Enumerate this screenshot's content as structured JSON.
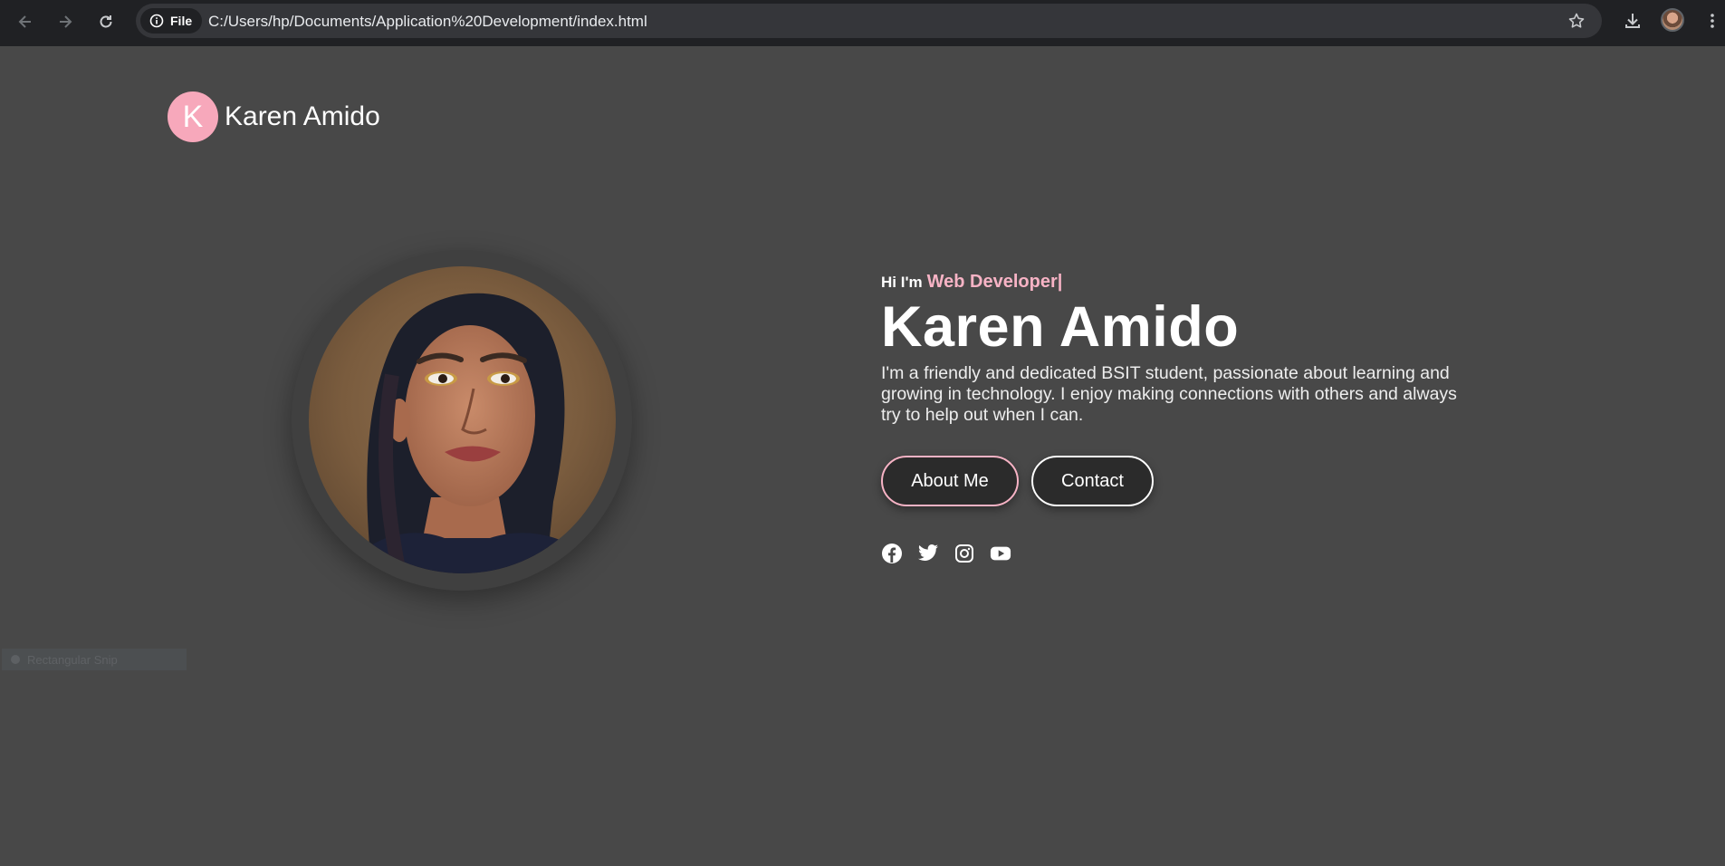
{
  "browser": {
    "chip_label": "File",
    "url": "C:/Users/hp/Documents/Application%20Development/index.html"
  },
  "header": {
    "logo_letter": "K",
    "logo_name": "Karen Amido"
  },
  "hero": {
    "greeting": "Hi I'm",
    "role": "Web Developer|",
    "name": "Karen Amido",
    "bio": "I'm a friendly and dedicated BSIT student, passionate about learning and growing in technology. I enjoy making connections with others and always try to help out when I can."
  },
  "buttons": {
    "about": "About Me",
    "contact": "Contact"
  },
  "socials": [
    "facebook-icon",
    "twitter-icon",
    "instagram-icon",
    "youtube-icon"
  ],
  "overlay": {
    "snip_label": "Rectangular Snip"
  },
  "colors": {
    "page_bg": "#484848",
    "accent_pink": "#f7a8bb",
    "role_pink": "#f7b3c5",
    "button_bg": "#2b2b2b"
  }
}
